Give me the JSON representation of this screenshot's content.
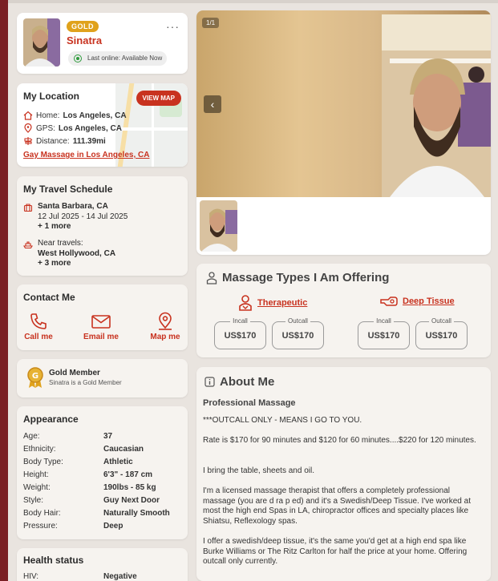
{
  "profile": {
    "badge": "GOLD",
    "name": "Sinatra",
    "status": "Last online: Available Now"
  },
  "location": {
    "title": "My Location",
    "view_map": "VIEW MAP",
    "home_label": "Home:",
    "home_value": "Los Angeles, CA",
    "gps_label": "GPS:",
    "gps_value": "Los Angeles, CA",
    "distance_label": "Distance:",
    "distance_value": "111.39mi",
    "link": "Gay Massage in Los Angeles, CA"
  },
  "travel": {
    "title": "My Travel Schedule",
    "trip_city": "Santa Barbara, CA",
    "trip_dates": "12 Jul 2025 - 14 Jul 2025",
    "trip_more": "+ 1 more",
    "near_label": "Near travels:",
    "near_city": "West Hollywood, CA",
    "near_more": "+ 3 more"
  },
  "contact": {
    "title": "Contact Me",
    "call": "Call me",
    "email": "Email me",
    "map": "Map me"
  },
  "gold": {
    "title": "Gold Member",
    "subtitle": "Sinatra is a Gold Member"
  },
  "appearance": {
    "title": "Appearance",
    "rows": [
      {
        "k": "Age:",
        "v": "37"
      },
      {
        "k": "Ethnicity:",
        "v": "Caucasian"
      },
      {
        "k": "Body Type:",
        "v": "Athletic"
      },
      {
        "k": "Height:",
        "v": "6'3\" - 187 cm"
      },
      {
        "k": "Weight:",
        "v": "190lbs - 85 kg"
      },
      {
        "k": "Style:",
        "v": "Guy Next Door"
      },
      {
        "k": "Body Hair:",
        "v": "Naturally Smooth"
      },
      {
        "k": "Pressure:",
        "v": "Deep"
      }
    ]
  },
  "health": {
    "title": "Health status",
    "hiv_label": "HIV:",
    "hiv_value": "Negative"
  },
  "gallery": {
    "counter": "1/1"
  },
  "massage": {
    "title": "Massage Types I Am Offering",
    "types": [
      {
        "name": "Therapeutic",
        "incall_label": "Incall",
        "incall": "US$170",
        "outcall_label": "Outcall",
        "outcall": "US$170"
      },
      {
        "name": "Deep Tissue",
        "incall_label": "Incall",
        "incall": "US$170",
        "outcall_label": "Outcall",
        "outcall": "US$170"
      }
    ]
  },
  "about": {
    "title": "About Me",
    "subtitle": "Professional Massage",
    "p1": "***OUTCALL ONLY - MEANS I GO TO YOU.",
    "p2": "Rate is $170 for 90 minutes and $120 for 60 minutes....$220 for 120 minutes.",
    "p3": "I bring the table, sheets and oil.",
    "p4": "I'm a licensed massage therapist that offers a completely professional massage (you are d ra p ed) and it's a Swedish/Deep Tissue. I've worked at most the high end Spas in LA, chiropractor offices and specialty places like Shiatsu, Reflexology spas.",
    "p5": "I offer a swedish/deep tissue, it's the same you'd get at a high end spa like Burke Williams or The Ritz Carlton for half the price at your home. Offering outcall only currently."
  }
}
